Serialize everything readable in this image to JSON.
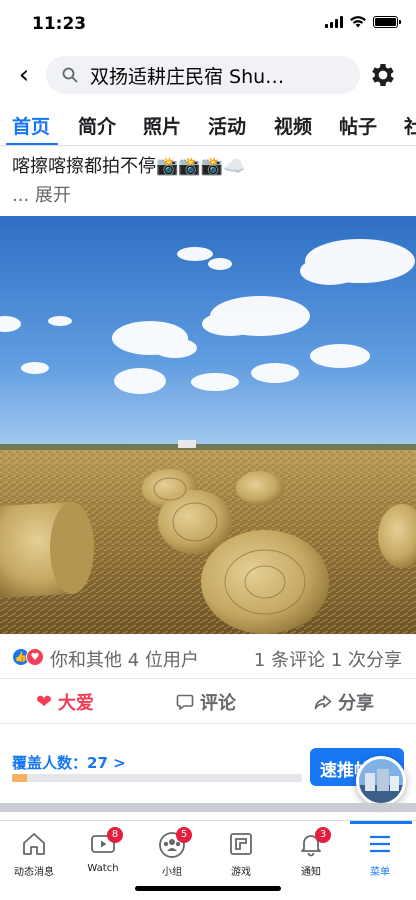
{
  "status": {
    "time": "11:23"
  },
  "header": {
    "back_icon": "back-arrow-icon",
    "search_text": "双扬适耕庄民宿 Shu…",
    "settings_icon": "gear-icon"
  },
  "tabs": [
    {
      "label": "首页",
      "active": true
    },
    {
      "label": "简介"
    },
    {
      "label": "照片"
    },
    {
      "label": "活动"
    },
    {
      "label": "视频"
    },
    {
      "label": "帖子"
    },
    {
      "label": "社"
    }
  ],
  "post": {
    "text": "喀擦喀擦都拍不停📸📸📸☁️",
    "see_more": "... 展开",
    "photo_description_icon": "hay-bale-field-photo"
  },
  "reactions": {
    "summary": "你和其他 4 位用户",
    "comments": "1 条评论",
    "shares": "1 次分享"
  },
  "actions": {
    "love_label": "大爱",
    "comment_label": "评论",
    "share_label": "分享"
  },
  "reach": {
    "label": "覆盖人数：27 >",
    "progress": 0.05,
    "boost_label": "速推帖子"
  },
  "nav": [
    {
      "label": "动态消息",
      "icon": "home-icon"
    },
    {
      "label": "Watch",
      "icon": "watch-icon",
      "badge": "8"
    },
    {
      "label": "小组",
      "icon": "groups-icon",
      "badge": "5"
    },
    {
      "label": "游戏",
      "icon": "gaming-icon"
    },
    {
      "label": "通知",
      "icon": "bell-icon",
      "badge": "3"
    },
    {
      "label": "菜单",
      "icon": "menu-icon",
      "active": true
    }
  ],
  "colors": {
    "accent": "#1877f2",
    "love": "#f33e58",
    "badge": "#e41e3f"
  }
}
